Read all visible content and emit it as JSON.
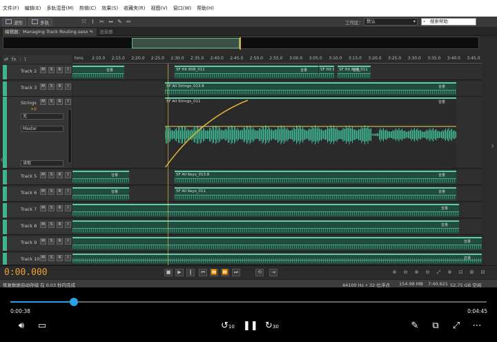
{
  "menu": [
    "文件(F)",
    "编辑(E)",
    "多轨混音(M)",
    "剪辑(C)",
    "效果(S)",
    "收藏夹(R)",
    "视图(V)",
    "窗口(W)",
    "帮助(H)"
  ],
  "toolbar": {
    "waveform": "波形",
    "multitrack": "多轨",
    "workspace_label": "工作区：",
    "workspace_value": "默认",
    "search_placeholder": "搜索帮助"
  },
  "editor": {
    "tab": "编辑器：Managing Track Routing.sesx *",
    "mixer_tab": "混音器"
  },
  "ruler": {
    "unit": "hms",
    "ticks": [
      "2:10.0",
      "2:15.0",
      "2:20.0",
      "2:25.0",
      "2:30.0",
      "2:35.0",
      "2:40.0",
      "2:45.0",
      "2:50.0",
      "2:55.0",
      "3:00.0",
      "3:05.0",
      "3:10.0",
      "3:15.0",
      "3:20.0",
      "3:25.0",
      "3:30.0",
      "3:35.0",
      "3:40.0",
      "3:45.0"
    ]
  },
  "tracks": [
    {
      "name": "Track 2",
      "clips": [
        {
          "label": "",
          "vol": "音量"
        },
        {
          "label": "SF Hit 808_011",
          "vol": "音量"
        },
        {
          "label": "SF Hit 808_011",
          "vol": ""
        },
        {
          "label": "SF Hit 808_011",
          "vol": "音量"
        }
      ]
    },
    {
      "name": "Track 3",
      "clips": [
        {
          "label": "SF All Strings_013.8",
          "vol": "音量"
        }
      ]
    },
    {
      "name": "Strings",
      "clips": [
        {
          "label": "SF All Strings_011",
          "vol": "音量"
        }
      ],
      "input": "无",
      "output": "Master",
      "read": "读取",
      "gain": "+0"
    },
    {
      "name": "Track 5",
      "clips": [
        {
          "label": "",
          "vol": "音量"
        },
        {
          "label": "SF All Keys_013.8",
          "vol": "音量"
        }
      ]
    },
    {
      "name": "Track 6",
      "clips": [
        {
          "label": "",
          "vol": "音量"
        },
        {
          "label": "SF All Keys_011",
          "vol": "音量"
        }
      ]
    },
    {
      "name": "Track 7",
      "clips": [
        {
          "label": "",
          "vol": "音量"
        }
      ]
    },
    {
      "name": "Track 8",
      "clips": [
        {
          "label": "",
          "vol": "音量"
        }
      ]
    },
    {
      "name": "Track 9",
      "clips": [
        {
          "label": "",
          "vol": "音量"
        }
      ]
    },
    {
      "name": "Track 10",
      "clips": [
        {
          "label": "",
          "vol": "音量"
        }
      ]
    }
  ],
  "track_buttons": [
    "M",
    "S",
    "R",
    "I"
  ],
  "transport": {
    "time": "0:00.000"
  },
  "status": {
    "left": "恢复数据自动存储 在 0.03 秒内完成",
    "rate": "44100 Hz • 32 位浮点",
    "size": "154.98 MB",
    "duration": "7:40.621",
    "free": "52.75 GB 空闲"
  },
  "player": {
    "elapsed": "0:00:38",
    "total": "0:04:45",
    "progress": 0.134,
    "skip_back": "10",
    "skip_fwd": "30"
  },
  "colors": {
    "clip": "#1f4c3f",
    "accent": "#3fb58c",
    "time": "#f0a23a",
    "seek": "#2aa0e6"
  }
}
